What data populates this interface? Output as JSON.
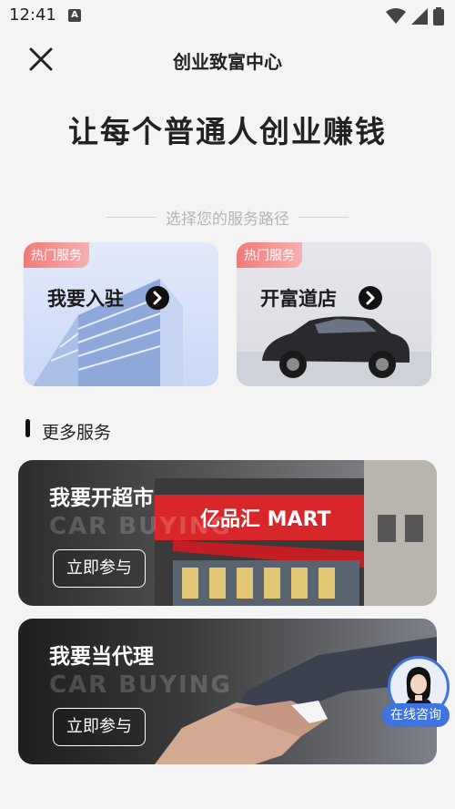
{
  "status": {
    "time": "12:41",
    "notif_glyph": "A"
  },
  "header": {
    "title": "创业致富中心"
  },
  "headline": "让每个普通人创业赚钱",
  "section_subtitle": "选择您的服务路径",
  "service_cards": [
    {
      "tag": "热门服务",
      "title": "我要入驻"
    },
    {
      "tag": "热门服务",
      "title": "开富道店"
    }
  ],
  "more_services": {
    "title": "更多服务",
    "cards": [
      {
        "title": "我要开超市",
        "subtitle": "CAR BUYING",
        "button": "立即参与",
        "store_sign": "亿品汇 MART"
      },
      {
        "title": "我要当代理",
        "subtitle": "CAR BUYING",
        "button": "立即参与"
      }
    ]
  },
  "consult": {
    "label": "在线咨询"
  },
  "colors": {
    "accent": "#3f74e0",
    "tag": "#f07a7a",
    "store_red": "#d8262b"
  }
}
